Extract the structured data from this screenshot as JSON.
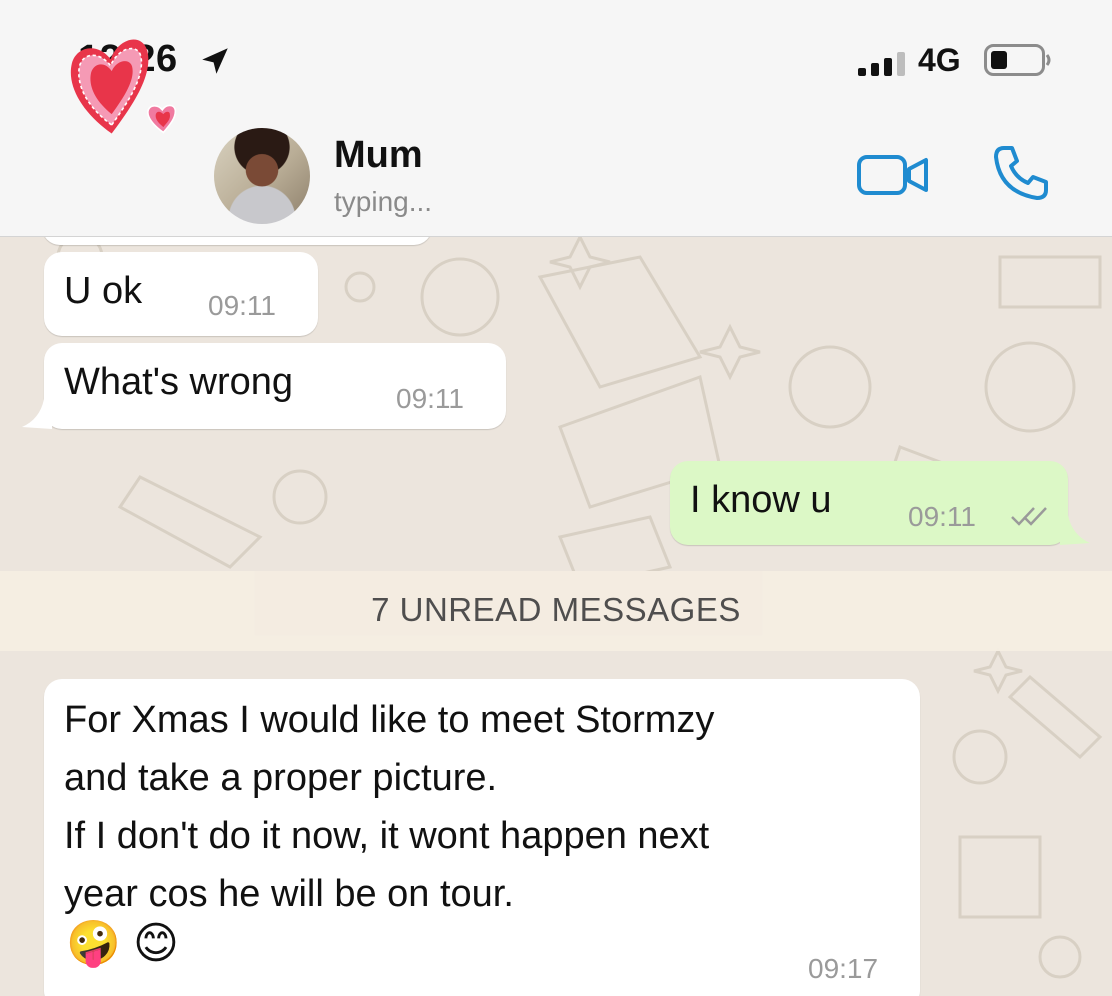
{
  "status_bar": {
    "time": "12:26",
    "network": "4G",
    "location_icon": "location-arrow-icon",
    "signal_icon": "signal-bars-icon",
    "battery_icon": "battery-icon"
  },
  "header": {
    "contact_name": "Mum",
    "contact_status": "typing...",
    "video_icon": "video-camera-icon",
    "call_icon": "phone-icon",
    "sticker_icon": "hearts-sticker-icon",
    "accent_color": "#1f8bd0"
  },
  "messages": [
    {
      "direction": "in",
      "text": "U ok",
      "time": "09:11"
    },
    {
      "direction": "in",
      "text": "What's wrong",
      "time": "09:11"
    },
    {
      "direction": "out",
      "text": "I know u",
      "time": "09:11",
      "status": "read"
    }
  ],
  "unread_banner": "7 UNREAD MESSAGES",
  "unread_messages": [
    {
      "direction": "in",
      "lines": [
        "For Xmas I would like to meet Stormzy",
        "and take a proper picture.",
        "If I don't do it now, it wont happen next",
        "year cos he will be on tour."
      ],
      "emojis": "🤪 😊",
      "time": "09:17"
    }
  ],
  "colors": {
    "incoming_bubble": "#ffffff",
    "outgoing_bubble": "#dcf8c6",
    "chat_background": "#ece5dd"
  }
}
